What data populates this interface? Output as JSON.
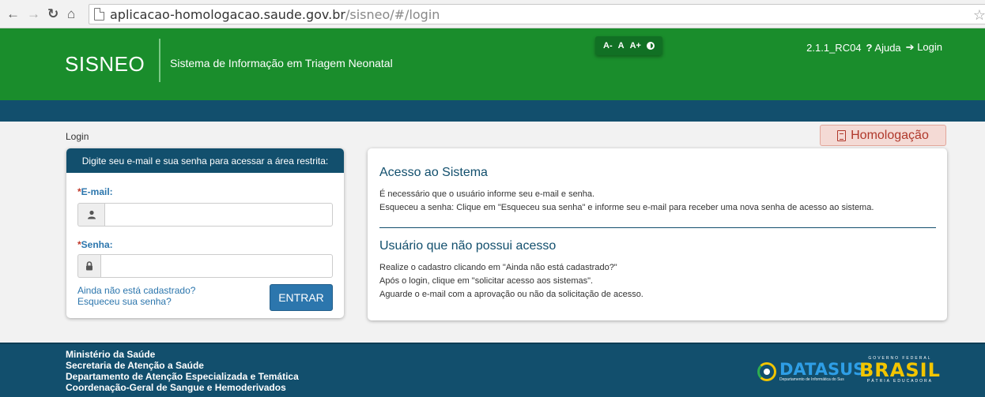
{
  "browser": {
    "url_host": "aplicacao-homologacao.saude.gov.br",
    "url_path": "/sisneo/#/login"
  },
  "header": {
    "logo": "SISNEO",
    "subtitle": "Sistema de Informação em Triagem Neonatal",
    "font_decrease": "A-",
    "font_normal": "A",
    "font_increase": "A+",
    "version": "2.1.1_RC04",
    "help": "Ajuda",
    "login": "Login"
  },
  "breadcrumb": "Login",
  "badge": "Homologação",
  "login_panel": {
    "title": "Digite seu e-mail e sua senha para acessar a área restrita:",
    "email_label": "E-mail:",
    "password_label": "Senha:",
    "required_mark": "*",
    "email_value": "",
    "password_value": "",
    "register_link": "Ainda não está cadastrado?",
    "forgot_link": "Esqueceu sua senha?",
    "submit": "ENTRAR"
  },
  "info_panel": {
    "section1_title": "Acesso ao Sistema",
    "section1_lines": [
      "É necessário que o usuário informe seu e-mail e senha.",
      "Esqueceu a senha: Clique em \"Esqueceu sua senha\" e informe seu e-mail para receber uma nova senha de acesso ao sistema."
    ],
    "section2_title": "Usuário que não possui acesso",
    "section2_lines": [
      "Realize o cadastro clicando em \"Ainda não está cadastrado?\"",
      "Após o login, clique em \"solicitar acesso aos sistemas\".",
      "Aguarde o e-mail com a aprovação ou não da solicitação de acesso."
    ]
  },
  "footer": {
    "lines": [
      "Ministério da Saúde",
      "Secretaria de Atenção a Saúde",
      "Departamento de Atenção Especializada e Temática",
      "Coordenação-Geral de Sangue e Hemoderivados"
    ],
    "datasus_name": "DATASUS",
    "datasus_sub": "Departamento de Informática do Sus",
    "brasil_top": "GOVERNO FEDERAL",
    "brasil_name": "BRASIL",
    "brasil_bottom": "PÁTRIA EDUCADORA"
  },
  "colors": {
    "header_green": "#1a8d2c",
    "navy": "#124f6d",
    "link_blue": "#2c76ad",
    "badge_red": "#b0382b"
  },
  "icons": [
    "back-arrow-icon",
    "forward-arrow-icon",
    "reload-icon",
    "home-icon",
    "page-icon",
    "star-icon",
    "contrast-icon",
    "question-icon",
    "login-icon",
    "user-icon",
    "lock-icon",
    "document-icon"
  ]
}
